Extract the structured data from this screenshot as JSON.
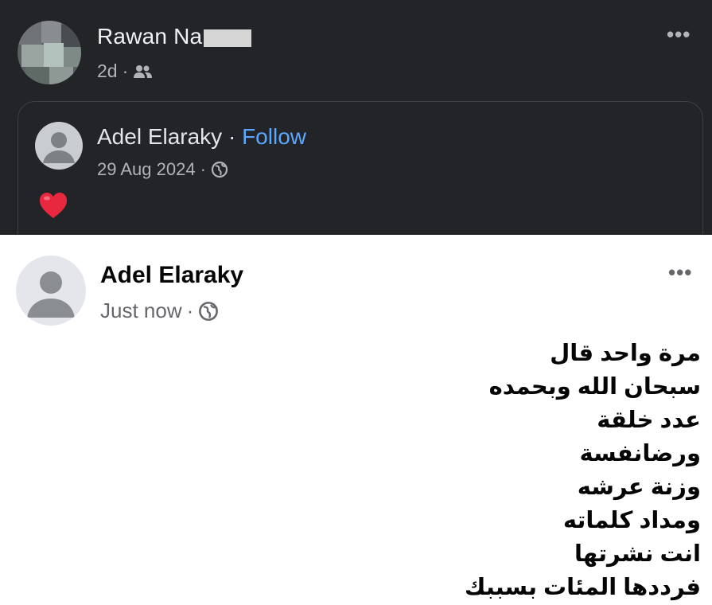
{
  "sharer": {
    "name_visible": "Rawan Na",
    "time": "2d",
    "separator": "·",
    "audience_icon": "friends-icon"
  },
  "shared_card": {
    "author": "Adel Elaraky",
    "separator": " · ",
    "follow_label": "Follow",
    "date": "29 Aug 2024",
    "date_separator": "·",
    "audience_icon": "globe-icon",
    "reaction_icon": "heart-icon"
  },
  "post": {
    "author": "Adel Elaraky",
    "time": "Just now",
    "separator": "·",
    "audience_icon": "globe-icon",
    "lines": [
      "مرة واحد قال",
      "سبحان الله وبحمده",
      "عدد خلقة",
      "ورضانفسة",
      "وزنة عرشه",
      "ومداد كلماته",
      "انت نشرتها",
      "فرددها المئات بسببك"
    ]
  },
  "more_label": "•••",
  "colors": {
    "dark_bg": "#232427",
    "follow": "#5aa7ff",
    "heart": "#e8283f"
  }
}
